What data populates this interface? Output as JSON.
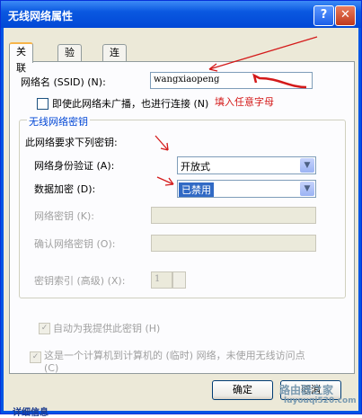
{
  "window": {
    "title": "无线网络属性",
    "help_symbol": "?",
    "close_symbol": "✕"
  },
  "tabs": [
    "关联",
    "验证",
    "连接"
  ],
  "ssid": {
    "label": "网络名 (SSID) (N):",
    "value": "wangxiaopeng"
  },
  "broadcast_checkbox_label": "即使此网络未广播，也进行连接 (N)",
  "annotation": "填入任意字母",
  "key_group": {
    "title": "无线网络密钥",
    "requirement_label": "此网络要求下列密钥:",
    "auth_label": "网络身份验证 (A):",
    "auth_value": "开放式",
    "encryption_label": "数据加密 (D):",
    "encryption_value": "已禁用",
    "network_key_label": "网络密钥 (K):",
    "confirm_key_label": "确认网络密钥 (O):",
    "key_index_label": "密钥索引 (高级) (X):",
    "key_index_value": "1",
    "auto_key_label": "自动为我提供此密钥 (H)"
  },
  "adhoc_checkbox_label": "这是一个计算机到计算机的 (临时) 网络，未使用无线访问点 (C)",
  "buttons": {
    "ok": "确定",
    "cancel": "取消"
  },
  "watermark": {
    "line1": "路由器之家",
    "line2": "luyouqi520.com"
  },
  "behind_text": "详细信息",
  "colors": {
    "annotation": "#d41a1a",
    "titlebar": "#0148d6",
    "dialog": "#ece9d8"
  }
}
